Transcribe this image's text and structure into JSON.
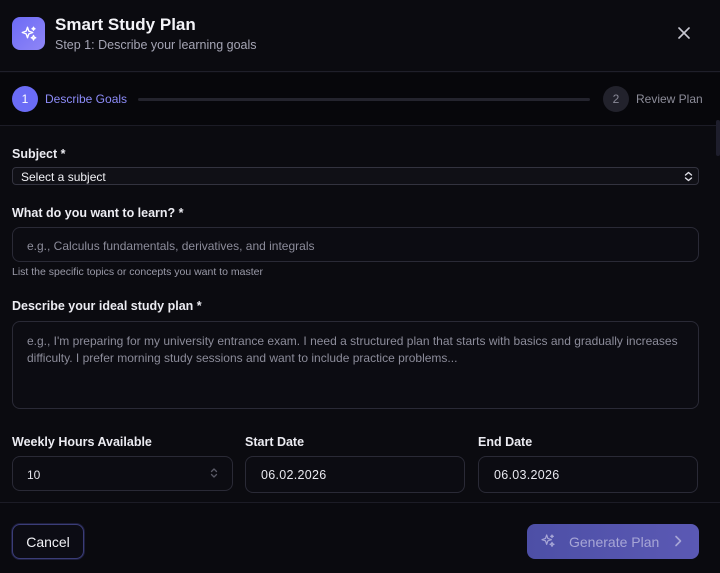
{
  "header": {
    "title": "Smart Study Plan",
    "subtitle": "Step 1: Describe your learning goals",
    "icon": "sparkles-icon",
    "close_icon": "close-icon"
  },
  "stepper": {
    "steps": [
      {
        "number": "1",
        "label": "Describe Goals",
        "active": true
      },
      {
        "number": "2",
        "label": "Review Plan",
        "active": false
      }
    ]
  },
  "form": {
    "subject": {
      "label": "Subject *",
      "value": "Select a subject"
    },
    "learn": {
      "label": "What do you want to learn? *",
      "placeholder": "e.g., Calculus fundamentals, derivatives, and integrals",
      "hint": "List the specific topics or concepts you want to master"
    },
    "plan": {
      "label": "Describe your ideal study plan *",
      "placeholder": "e.g., I'm preparing for my university entrance exam. I need a structured plan that starts with basics and gradually increases difficulty. I prefer morning study sessions and want to include practice problems..."
    },
    "weekly_hours": {
      "label": "Weekly Hours Available",
      "value": "10"
    },
    "start_date": {
      "label": "Start Date",
      "value": "06.02.2026"
    },
    "end_date": {
      "label": "End Date",
      "value": "06.03.2026"
    }
  },
  "footer": {
    "cancel_label": "Cancel",
    "generate_label": "Generate Plan"
  },
  "colors": {
    "accent": "#6b6cf6",
    "background": "#0b0b10"
  }
}
